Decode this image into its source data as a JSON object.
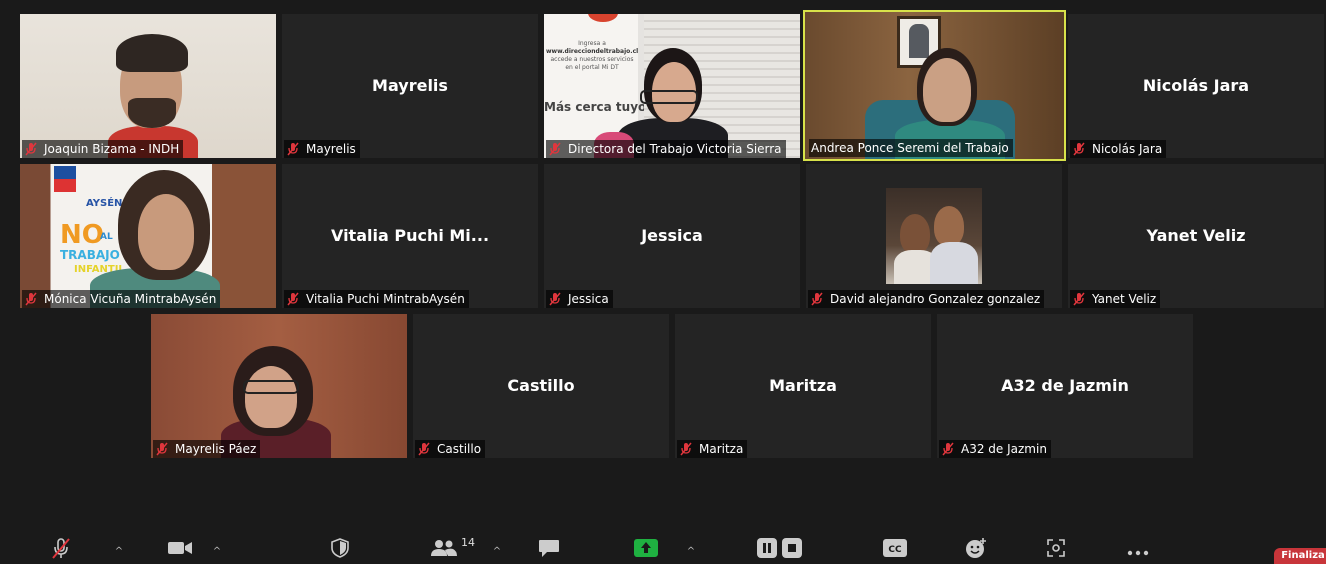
{
  "gallery": {
    "row1": [
      {
        "label": "Joaquin Bizama - INDH",
        "type": "video"
      },
      {
        "label": "Mayrelis",
        "big_name": "Mayrelis",
        "type": "name"
      },
      {
        "label": "Directora del Trabajo Victoria Sierra",
        "type": "video",
        "poster_lines": [
          "Ingresa a",
          "www.direcciondeltrabajo.cl",
          "accede a nuestros servicios",
          "en el portal Mi DT",
          "Más cerca tuyo"
        ]
      },
      {
        "label": "Andrea Ponce Seremi del Trabajo",
        "type": "video",
        "active": true
      },
      {
        "label": "Nicolás Jara",
        "big_name": "Nicolás Jara",
        "type": "name"
      }
    ],
    "row2": [
      {
        "label": "Mónica Vicuña MintrabAysén",
        "type": "video",
        "poster_lines": [
          "AYSÉN",
          "NO",
          "AL",
          "TRABAJO",
          "INFANTIL"
        ]
      },
      {
        "label": "Vitalia Puchi MintrabAysén",
        "big_name": "Vitalia Puchi Mi...",
        "type": "name"
      },
      {
        "label": "Jessica",
        "big_name": "Jessica",
        "type": "name"
      },
      {
        "label": "David alejandro Gonzalez gonzalez",
        "type": "photo"
      },
      {
        "label": "Yanet Veliz",
        "big_name": "Yanet Veliz",
        "type": "name"
      }
    ],
    "row3": [
      {
        "label": "Mayrelis Páez",
        "type": "video"
      },
      {
        "label": "Castillo",
        "big_name": "Castillo",
        "type": "name"
      },
      {
        "label": "Maritza",
        "big_name": "Maritza",
        "type": "name"
      },
      {
        "label": "A32 de Jazmin",
        "big_name": "A32 de Jazmin",
        "type": "name"
      }
    ]
  },
  "toolbar": {
    "participants_count": "14",
    "end_label": "Finaliza",
    "icons": [
      "mic-muted-icon",
      "video-camera-icon",
      "shield-icon",
      "participants-icon",
      "chat-icon",
      "share-screen-icon",
      "pause-record-icon",
      "stop-record-icon",
      "closed-captions-icon",
      "reactions-icon",
      "apps-icon",
      "more-icon"
    ]
  },
  "colors": {
    "background": "#1a1a1a",
    "tile": "#242424",
    "active_speaker": "#d8e24a",
    "share_green": "#1fb141",
    "end_red": "#c8353a",
    "mute_red": "#e0363d"
  }
}
